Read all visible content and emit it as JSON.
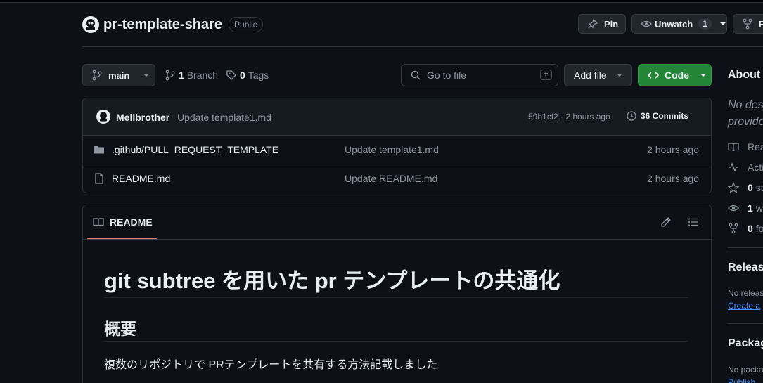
{
  "repo": {
    "name": "pr-template-share",
    "visibility": "Public"
  },
  "header_actions": {
    "pin": "Pin",
    "unwatch": "Unwatch",
    "watch_count": "1",
    "fork_partial": "F"
  },
  "toolbar": {
    "branch": "main",
    "branches_count": "1",
    "branches_label": "Branch",
    "tags_count": "0",
    "tags_label": "Tags",
    "goto_placeholder": "Go to file",
    "goto_key": "t",
    "add_file": "Add file",
    "code": "Code"
  },
  "commit": {
    "author": "Mellbrother",
    "message": "Update template1.md",
    "meta": "59b1cf2 · 2 hours ago",
    "commits": "36 Commits"
  },
  "files": [
    {
      "name": ".github/PULL_REQUEST_TEMPLATE",
      "type": "folder",
      "message": "Update template1.md",
      "time": "2 hours ago"
    },
    {
      "name": "README.md",
      "type": "file",
      "message": "Update README.md",
      "time": "2 hours ago"
    }
  ],
  "readme": {
    "tab": "README",
    "h1": "git subtree を用いた pr テンプレートの共通化",
    "h2": "概要",
    "p": "複数のリポジトリで PRテンプレートを共有する方法記載しました"
  },
  "sidebar": {
    "about": "About",
    "desc1": "No des",
    "desc2": "provide",
    "readme": "Rea",
    "activity": "Acti",
    "stars_count": "0",
    "stars_partial": "st",
    "watching_count": "1",
    "watching_partial": "w",
    "forks_count": "0",
    "forks_partial": "fo",
    "releases": "Releas",
    "no_releases": "No releas",
    "create": "Create a",
    "packages": "Packag",
    "no_packages": "No packa",
    "publish": "Publish"
  },
  "colors": {
    "bg": "#0d1117",
    "border": "#30363d",
    "accent": "#238636",
    "link": "#4493f8",
    "tab_underline": "#f78166"
  }
}
